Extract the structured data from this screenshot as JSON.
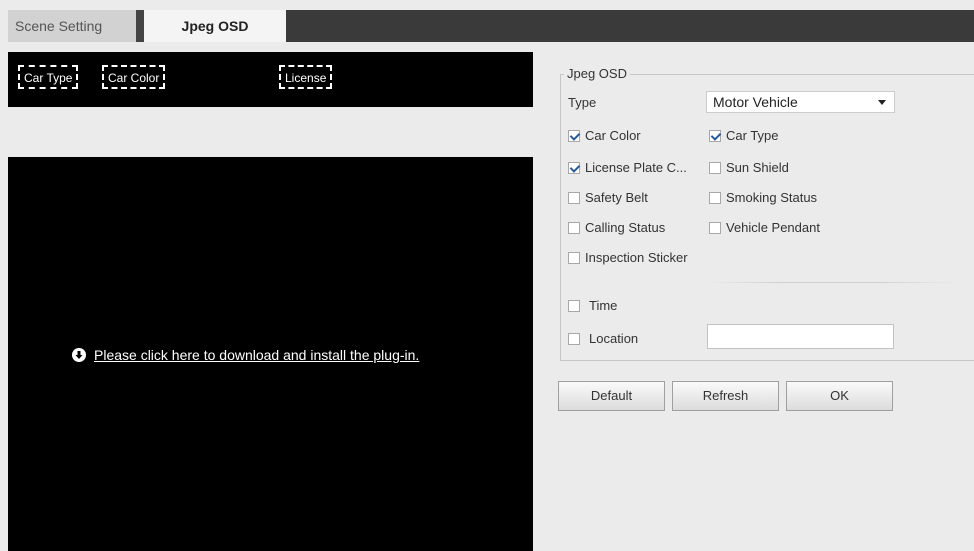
{
  "tabs": [
    {
      "label": "Scene Setting"
    },
    {
      "label": "Jpeg OSD"
    }
  ],
  "osd_tags": [
    "Car Type",
    "Car Color",
    "License"
  ],
  "plugin_link": {
    "text": "Please click here to download and install the plug-in."
  },
  "jpeg_osd": {
    "legend": "Jpeg OSD",
    "type_label": "Type",
    "type_value": "Motor Vehicle",
    "checkboxes": [
      {
        "label": "Car Color",
        "checked": true
      },
      {
        "label": "Car Type",
        "checked": true
      },
      {
        "label": "License Plate C...",
        "checked": true
      },
      {
        "label": "Sun Shield",
        "checked": false
      },
      {
        "label": "Safety Belt",
        "checked": false
      },
      {
        "label": "Smoking Status",
        "checked": false
      },
      {
        "label": "Calling Status",
        "checked": false
      },
      {
        "label": "Vehicle Pendant",
        "checked": false
      },
      {
        "label": "Inspection Sticker",
        "checked": false
      }
    ],
    "time_label": "Time",
    "location_label": "Location",
    "location_value": ""
  },
  "buttons": {
    "default": "Default",
    "refresh": "Refresh",
    "ok": "OK"
  }
}
